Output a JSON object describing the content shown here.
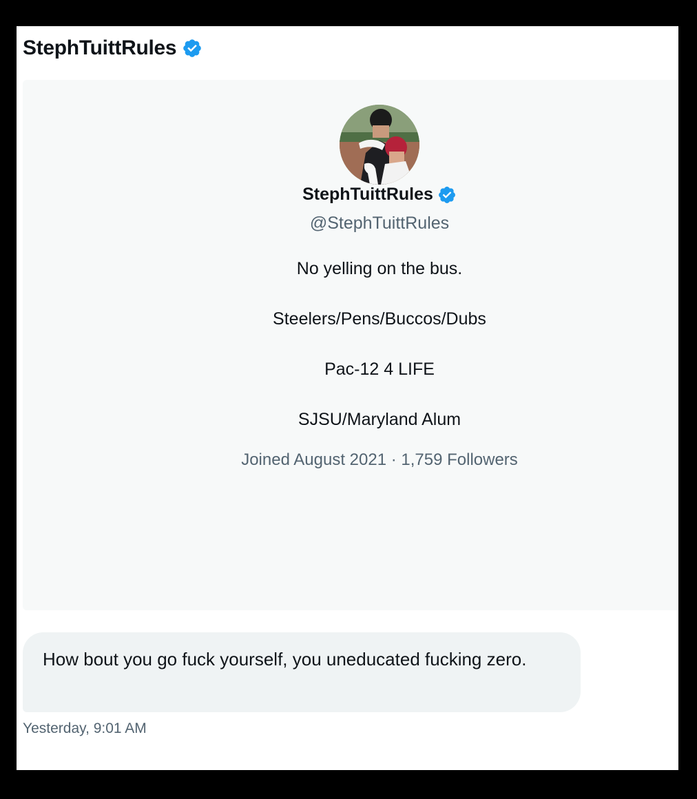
{
  "header": {
    "title": "StephTuittRules",
    "verified_icon": "verified-badge-icon"
  },
  "profile": {
    "avatar_icon": "profile-avatar",
    "name": "StephTuittRules",
    "handle": "@StephTuittRules",
    "bio_lines": [
      "No yelling on the bus.",
      "Steelers/Pens/Buccos/Dubs",
      "Pac-12 4 LIFE",
      "SJSU/Maryland Alum"
    ],
    "meta": "Joined August 2021 · 1,759 Followers"
  },
  "message": {
    "text": "How bout you go fuck yourself, you uneducated fucking zero.",
    "timestamp": "Yesterday, 9:01 AM"
  },
  "colors": {
    "verified_blue": "#1d9bf0",
    "text_primary": "#0f1419",
    "text_secondary": "#536471",
    "card_bg": "#f7f9f9",
    "bubble_bg": "#eff3f4"
  }
}
